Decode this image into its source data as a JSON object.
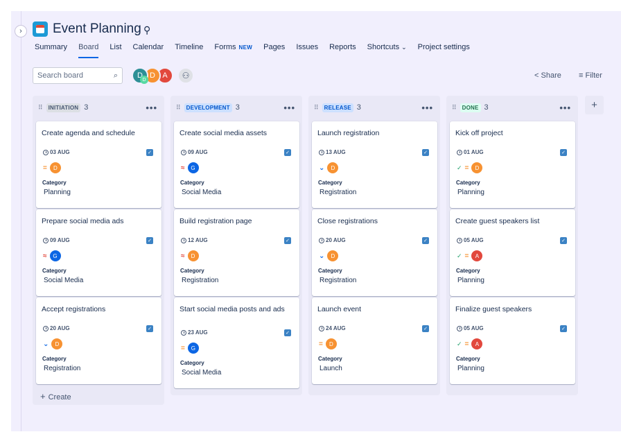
{
  "project": {
    "title": "Event Planning"
  },
  "nav": [
    {
      "label": "Summary"
    },
    {
      "label": "Board",
      "active": true
    },
    {
      "label": "List"
    },
    {
      "label": "Calendar"
    },
    {
      "label": "Timeline"
    },
    {
      "label": "Forms",
      "badge": "NEW"
    },
    {
      "label": "Pages"
    },
    {
      "label": "Issues"
    },
    {
      "label": "Reports"
    },
    {
      "label": "Shortcuts",
      "dropdown": true
    },
    {
      "label": "Project settings"
    }
  ],
  "search": {
    "placeholder": "Search board"
  },
  "avatars": [
    {
      "initial": "D",
      "color": "#2d8f96"
    },
    {
      "initial": "D",
      "color": "#f79232"
    },
    {
      "initial": "A",
      "color": "#e2483d"
    }
  ],
  "avatar_sub": {
    "initial": "D",
    "color": "#57d9a3"
  },
  "toolbar": {
    "share": "Share",
    "filter": "Filter"
  },
  "labels": {
    "category": "Category",
    "create": "Create",
    "dots": "•••"
  },
  "colors": {
    "avatar_d": "#f79232",
    "avatar_g": "#0c66e4",
    "avatar_a": "#e2483d",
    "priority_high": "#e2483d",
    "priority_medium": "#f79232",
    "priority_low": "#0c66e4"
  },
  "columns": [
    {
      "name": "INITIATION",
      "count": "3",
      "lozenge_bg": "#dcdfe4",
      "lozenge_fg": "#44546f",
      "cards": [
        {
          "title": "Create agenda and schedule",
          "date": "03 AUG",
          "priority": "medium",
          "avatar": "D",
          "category": "Planning",
          "done": false
        },
        {
          "title": "Prepare social media ads",
          "date": "09 AUG",
          "priority": "high",
          "avatar": "G",
          "category": "Social Media",
          "done": false
        },
        {
          "title": "Accept registrations",
          "date": "20 AUG",
          "priority": "low",
          "avatar": "D",
          "category": "Registration",
          "done": false
        }
      ]
    },
    {
      "name": "DEVELOPMENT",
      "count": "3",
      "lozenge_bg": "#cce0ff",
      "lozenge_fg": "#0055cc",
      "cards": [
        {
          "title": "Create social media assets",
          "date": "09 AUG",
          "priority": "high",
          "avatar": "G",
          "category": "Social Media",
          "done": false
        },
        {
          "title": "Build registration page",
          "date": "12 AUG",
          "priority": "high",
          "avatar": "D",
          "category": "Registration",
          "done": false
        },
        {
          "title": "Start social media posts and ads",
          "date": "23 AUG",
          "priority": "medium",
          "avatar": "G",
          "category": "Social Media",
          "done": false
        }
      ]
    },
    {
      "name": "RELEASE",
      "count": "3",
      "lozenge_bg": "#cce0ff",
      "lozenge_fg": "#0055cc",
      "cards": [
        {
          "title": "Launch registration",
          "date": "13 AUG",
          "priority": "low",
          "avatar": "D",
          "category": "Registration",
          "done": false
        },
        {
          "title": "Close registrations",
          "date": "20 AUG",
          "priority": "low",
          "avatar": "D",
          "category": "Registration",
          "done": false
        },
        {
          "title": "Launch event",
          "date": "24 AUG",
          "priority": "medium",
          "avatar": "D",
          "category": "Launch",
          "done": false
        }
      ]
    },
    {
      "name": "DONE",
      "count": "3",
      "lozenge_bg": "#dcfff1",
      "lozenge_fg": "#216e4e",
      "cards": [
        {
          "title": "Kick off project",
          "date": "01 AUG",
          "priority": "medium",
          "avatar": "D",
          "category": "Planning",
          "done": true
        },
        {
          "title": "Create guest speakers list",
          "date": "05 AUG",
          "priority": "medium",
          "avatar": "A",
          "category": "Planning",
          "done": true
        },
        {
          "title": "Finalize guest speakers",
          "date": "05 AUG",
          "priority": "medium",
          "avatar": "A",
          "category": "Planning",
          "done": true
        }
      ]
    }
  ]
}
